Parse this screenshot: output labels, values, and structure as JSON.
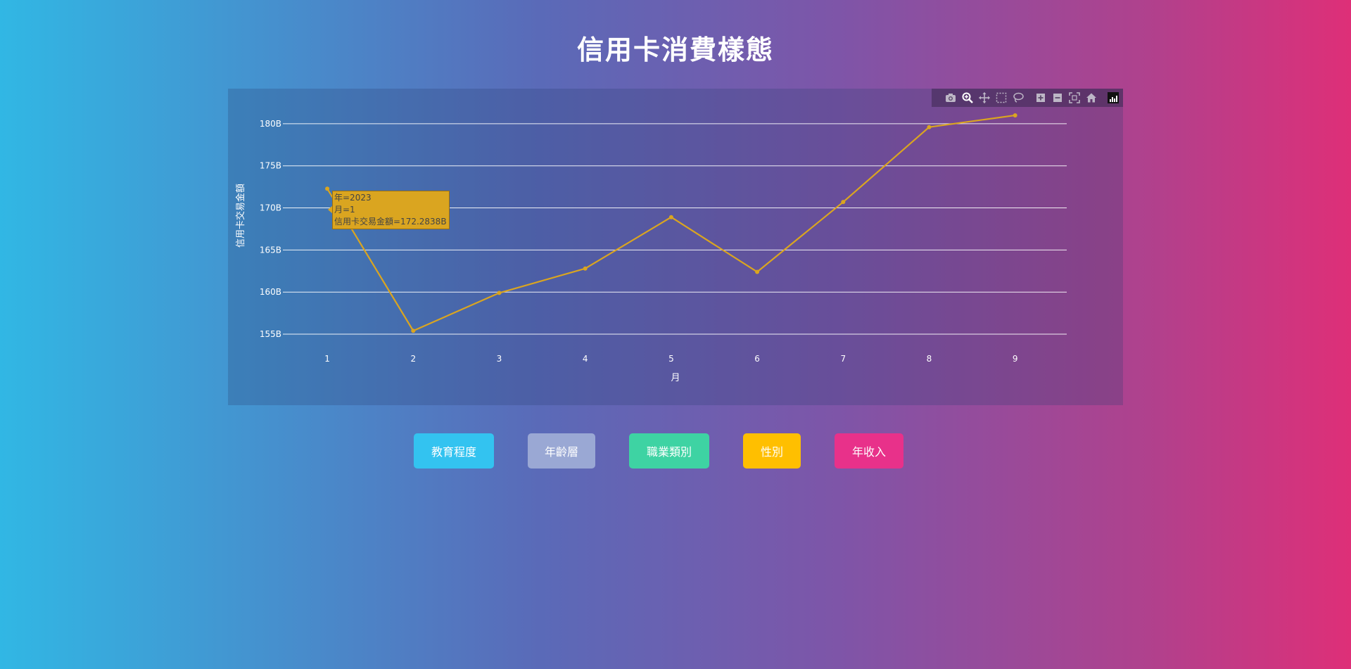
{
  "page": {
    "title": "信用卡消費樣態"
  },
  "chart_data": {
    "type": "line",
    "x": [
      1,
      2,
      3,
      4,
      5,
      6,
      7,
      8,
      9
    ],
    "series": [
      {
        "values": [
          172.2838,
          155.4,
          159.9,
          162.8,
          168.9,
          162.4,
          170.7,
          179.6,
          181.0
        ]
      }
    ],
    "xlabel": "月",
    "ylabel": "信用卡交易金額",
    "ylim": [
      154,
      182.5
    ],
    "yticks": [
      155,
      160,
      165,
      170,
      175,
      180
    ],
    "ytick_labels": [
      "155B",
      "160B",
      "165B",
      "170B",
      "175B",
      "180B"
    ],
    "xtick_labels": [
      "1",
      "2",
      "3",
      "4",
      "5",
      "6",
      "7",
      "8",
      "9"
    ],
    "grid": true,
    "line_color": "#daa520",
    "tooltip": {
      "point_index": 0,
      "lines": [
        "年=2023",
        "月=1",
        "信用卡交易金額=172.2838B"
      ]
    }
  },
  "modebar": {
    "icons": [
      "camera-icon",
      "zoom-icon",
      "pan-icon",
      "box-select-icon",
      "lasso-icon",
      "zoom-in-icon",
      "zoom-out-icon",
      "autoscale-icon",
      "reset-axes-icon",
      "plotly-logo-icon"
    ]
  },
  "buttons": [
    {
      "label": "教育程度",
      "color": "#33c3f0"
    },
    {
      "label": "年齡層",
      "color": "#9aa8d4"
    },
    {
      "label": "職業類別",
      "color": "#3ed3a3"
    },
    {
      "label": "性別",
      "color": "#ffbf00"
    },
    {
      "label": "年收入",
      "color": "#e8318a"
    }
  ]
}
